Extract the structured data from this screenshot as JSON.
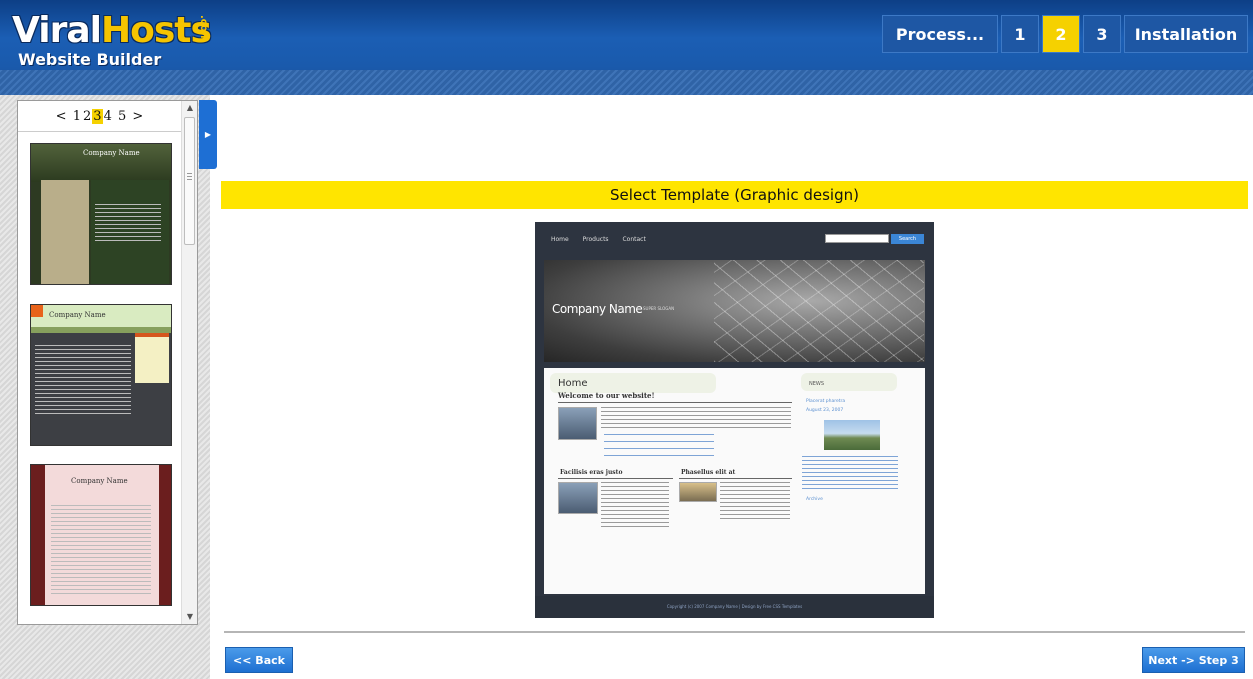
{
  "header": {
    "logo": {
      "brand_part1": "Viral",
      "brand_part2": "Hosts",
      "domain_suffix": ".com",
      "subtitle": "Website Builder"
    },
    "steps": [
      {
        "label": "Process...",
        "active": false
      },
      {
        "label": "1",
        "active": false
      },
      {
        "label": "2",
        "active": true
      },
      {
        "label": "3",
        "active": false
      },
      {
        "label": "Installation",
        "active": false
      }
    ]
  },
  "sidebar": {
    "pager": {
      "prev": "<",
      "pages": [
        "1",
        "2",
        "3",
        "4",
        "5"
      ],
      "current": "3",
      "next": ">"
    },
    "templates": [
      {
        "title": "Company Name"
      },
      {
        "title": "Company Name"
      },
      {
        "title": "Company Name"
      }
    ],
    "toggle_icon": "chevron-right-icon"
  },
  "main": {
    "banner": "Select Template (Graphic design)",
    "preview": {
      "nav": [
        "Home",
        "Products",
        "Contact"
      ],
      "search_button": "Search",
      "company_name": "Company Name",
      "slogan": "SUPER SLOGAN",
      "home_heading": "Home",
      "welcome": "Welcome to our website!",
      "col1_heading": "Facilisis eras justo",
      "col2_heading": "Phasellus elit at",
      "news_heading": "NEWS",
      "news_link1": "Placerat pharetra",
      "news_date": "August 23, 2007",
      "archive": "Archive",
      "footer": "Copyright (c) 2007 Company Name | Design by Free CSS Templates"
    },
    "buttons": {
      "back": "<< Back",
      "next": "Next -> Step 3"
    }
  },
  "colors": {
    "accent_yellow": "#ffe500",
    "header_blue": "#1b5eb4",
    "button_blue": "#1d6fd1"
  }
}
